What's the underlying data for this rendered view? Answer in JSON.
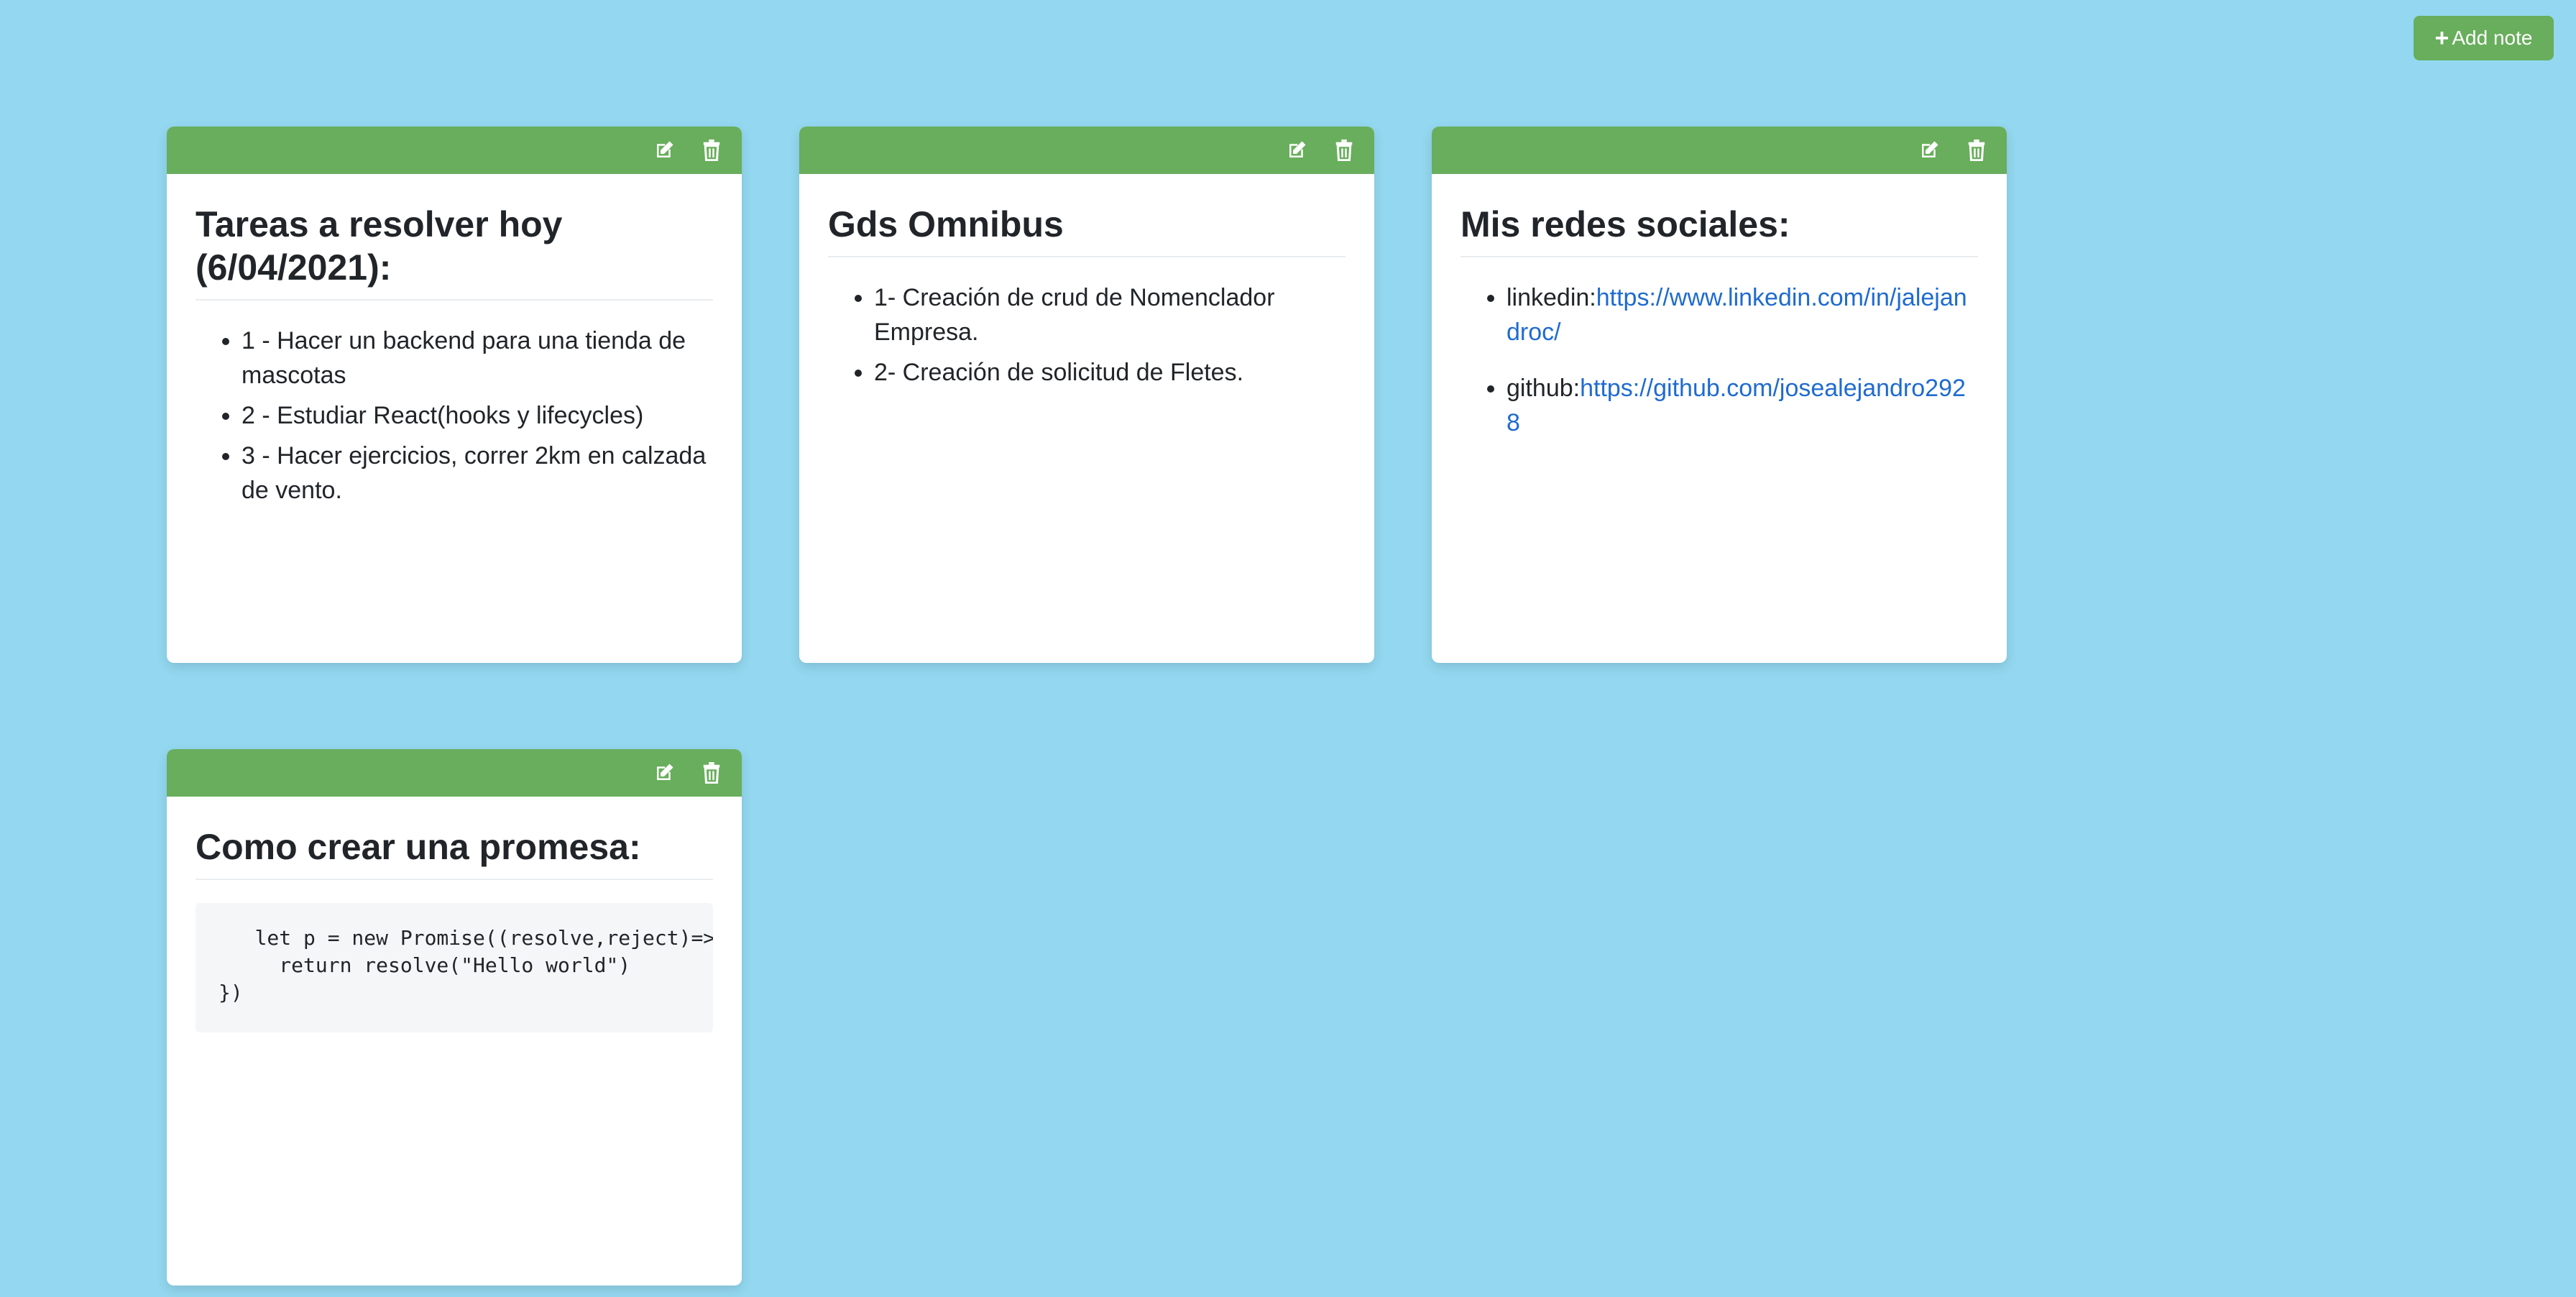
{
  "toolbar": {
    "add_label": "Add note"
  },
  "colors": {
    "background": "#93d8f0",
    "header": "#68ae5c",
    "link": "#1f6bd0"
  },
  "icons": {
    "add": "plus-icon",
    "edit": "edit-icon",
    "delete": "trash-icon"
  },
  "notes": [
    {
      "title": "Tareas a resolver hoy (6/04/2021):",
      "items": [
        "1 - Hacer un backend para una tienda de mascotas",
        "2 - Estudiar React(hooks y lifecycles)",
        "3 - Hacer ejercicios, correr 2km en calzada de vento."
      ]
    },
    {
      "title": "Gds Omnibus",
      "items": [
        "1- Creación de crud de Nomenclador Empresa.",
        "2- Creación de solicitud de Fletes."
      ]
    },
    {
      "title": "Mis redes sociales:",
      "links": [
        {
          "label": "linkedin:",
          "url": "https://www.linkedin.com/in/jalejandroc/"
        },
        {
          "label": "github:",
          "url": "https://github.com/josealejandro2928"
        }
      ]
    },
    {
      "title": "Como crear una promesa:",
      "code": "   let p = new Promise((resolve,reject)=>{\n     return resolve(\"Hello world\")\n})"
    }
  ]
}
